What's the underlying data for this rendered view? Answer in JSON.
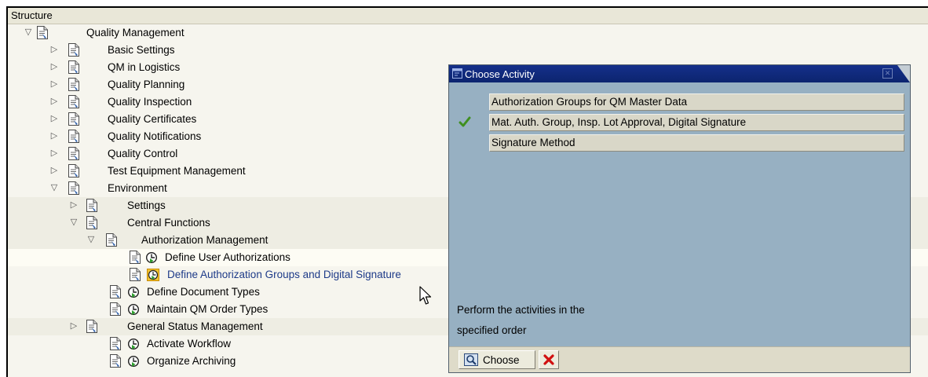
{
  "header": {
    "title": "Structure"
  },
  "tree": [
    {
      "label": "Quality Management",
      "level": 0,
      "expander": "open",
      "clock": false
    },
    {
      "label": "Basic Settings",
      "level": 1,
      "expander": "closed",
      "clock": false
    },
    {
      "label": "QM in Logistics",
      "level": 1,
      "expander": "closed",
      "clock": false
    },
    {
      "label": "Quality Planning",
      "level": 1,
      "expander": "closed",
      "clock": false
    },
    {
      "label": "Quality Inspection",
      "level": 1,
      "expander": "closed",
      "clock": false
    },
    {
      "label": "Quality Certificates",
      "level": 1,
      "expander": "closed",
      "clock": false
    },
    {
      "label": "Quality Notifications",
      "level": 1,
      "expander": "closed",
      "clock": false
    },
    {
      "label": "Quality Control",
      "level": 1,
      "expander": "closed",
      "clock": false
    },
    {
      "label": "Test Equipment Management",
      "level": 1,
      "expander": "closed",
      "clock": false
    },
    {
      "label": "Environment",
      "level": 1,
      "expander": "open",
      "clock": false
    },
    {
      "label": "Settings",
      "level": 2,
      "expander": "closed",
      "clock": false
    },
    {
      "label": "Central Functions",
      "level": 2,
      "expander": "open",
      "clock": false
    },
    {
      "label": "Authorization Management",
      "level": 3,
      "expander": "open",
      "clock": false
    },
    {
      "label": "Define User Authorizations",
      "level": 4,
      "expander": "none",
      "clock": true
    },
    {
      "label": "Define Authorization Groups and Digital Signature",
      "level": 4,
      "expander": "none",
      "clock": true,
      "selected": true
    },
    {
      "label": "Define Document Types",
      "level": 3,
      "expander": "none",
      "clock": true
    },
    {
      "label": "Maintain QM Order Types",
      "level": 3,
      "expander": "none",
      "clock": true
    },
    {
      "label": "General Status Management",
      "level": 2,
      "expander": "closed",
      "clock": false
    },
    {
      "label": "Activate Workflow",
      "level": 3,
      "expander": "none",
      "clock": true
    },
    {
      "label": "Organize Archiving",
      "level": 3,
      "expander": "none",
      "clock": true
    }
  ],
  "dialog": {
    "title": "Choose Activity",
    "activities": [
      {
        "label": "Authorization Groups for QM Master Data",
        "done": false
      },
      {
        "label": "Mat. Auth. Group, Insp. Lot Approval, Digital Signature",
        "done": true
      },
      {
        "label": "Signature Method",
        "done": false
      }
    ],
    "hint_line1": "Perform the activities in the",
    "hint_line2": "specified order",
    "choose_label": "Choose"
  },
  "colors": {
    "title_bar": "#0c246f",
    "dialog_bg": "#97b0c2",
    "link": "#1d3a88",
    "selection": "#f2c230"
  }
}
